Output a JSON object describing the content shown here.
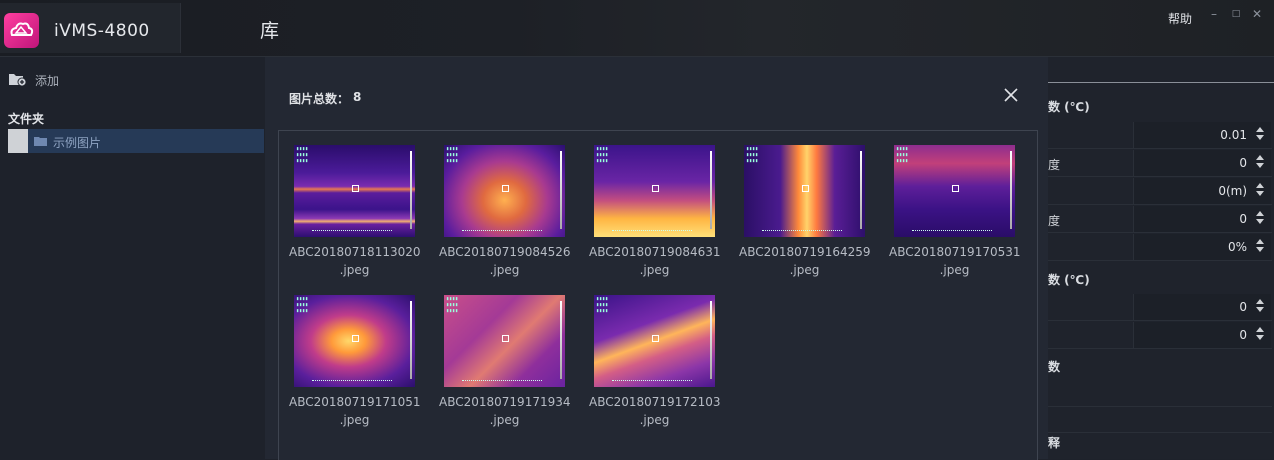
{
  "app": {
    "name": "iVMS-4800",
    "page_title": "库",
    "help_label": "帮助"
  },
  "window_buttons": {
    "minimize": "–",
    "maximize": "□",
    "close": "✕"
  },
  "sidebar": {
    "add_label": "添加",
    "folder_heading": "文件夹",
    "folders": [
      {
        "label": "示例图片"
      }
    ]
  },
  "dialog": {
    "count_label": "图片总数：",
    "count_value": "8",
    "images": [
      {
        "name": "ABC20180718113020",
        "ext": ".jpeg",
        "palette": "iron-lines"
      },
      {
        "name": "ABC20180719084526",
        "ext": ".jpeg",
        "palette": "iron-tower"
      },
      {
        "name": "ABC20180719084631",
        "ext": ".jpeg",
        "palette": "iron-tower-hot"
      },
      {
        "name": "ABC20180719164259",
        "ext": ".jpeg",
        "palette": "iron-cabinet"
      },
      {
        "name": "ABC20180719170531",
        "ext": ".jpeg",
        "palette": "iron-room"
      },
      {
        "name": "ABC20180719171051",
        "ext": ".jpeg",
        "palette": "iron-pipe"
      },
      {
        "name": "ABC20180719171934",
        "ext": ".jpeg",
        "palette": "iron-desk"
      },
      {
        "name": "ABC20180719172103",
        "ext": ".jpeg",
        "palette": "iron-hand"
      }
    ]
  },
  "right_panel": {
    "section1_title": "数 (℃)",
    "rows1": [
      {
        "label": "",
        "value": "0.01"
      },
      {
        "label": "度",
        "value": "0"
      },
      {
        "label": "",
        "value": "0(m)"
      },
      {
        "label": "度",
        "value": "0"
      },
      {
        "label": "",
        "value": "0%"
      }
    ],
    "section2_title": "数 (℃)",
    "rows2": [
      {
        "label": "",
        "value": "0"
      },
      {
        "label": "",
        "value": "0"
      }
    ],
    "section3_title": "数",
    "section4_title": "释"
  }
}
